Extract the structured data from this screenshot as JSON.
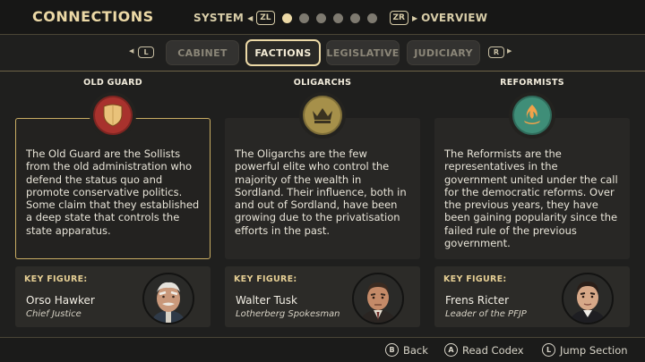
{
  "header": {
    "title": "CONNECTIONS",
    "left_label": "SYSTEM",
    "left_button": "ZL",
    "right_button": "ZR",
    "right_label": "OVERVIEW",
    "page_count": 6,
    "active_page": 1
  },
  "tabs": {
    "left_button": "L",
    "right_button": "R",
    "items": [
      {
        "label": "CABINET"
      },
      {
        "label": "FACTIONS"
      },
      {
        "label": "LEGISLATIVE"
      },
      {
        "label": "JUDICIARY"
      }
    ],
    "active": "FACTIONS"
  },
  "factions": [
    {
      "name": "OLD GUARD",
      "emblem": "shield-icon",
      "emblem_color": "#a8322d",
      "description": "The Old Guard are the Sollists from the old administration who defend the status quo and promote conservative politics. Some claim that they established a deep state that controls the state apparatus.",
      "key_label": "KEY FIGURE:",
      "key_name": "Orso Hawker",
      "key_role": "Chief Justice"
    },
    {
      "name": "OLIGARCHS",
      "emblem": "crown-icon",
      "emblem_color": "#a6904a",
      "description": "The Oligarchs are the few powerful elite who control the majority of the wealth in Sordland. Their influence, both in and out of Sordland, have been growing due to the privatisation efforts in the past.",
      "key_label": "KEY FIGURE:",
      "key_name": "Walter Tusk",
      "key_role": "Lotherberg Spokesman"
    },
    {
      "name": "REFORMISTS",
      "emblem": "flame-icon",
      "emblem_color": "#3f8e78",
      "description": "The Reformists are the representatives in the government united under the call for the democratic reforms. Over the previous years, they have been gaining popularity since the failed rule of the previous government.",
      "key_label": "KEY FIGURE:",
      "key_name": "Frens Ricter",
      "key_role": "Leader of the PFJP"
    }
  ],
  "footer": {
    "back_button": "B",
    "back_label": "Back",
    "codex_button": "A",
    "codex_label": "Read Codex",
    "jump_button": "L",
    "jump_label": "Jump Section"
  },
  "colors": {
    "accent": "#ecd9a6",
    "key_label": "#e6cf94",
    "selected_border": "#c9ad64"
  }
}
